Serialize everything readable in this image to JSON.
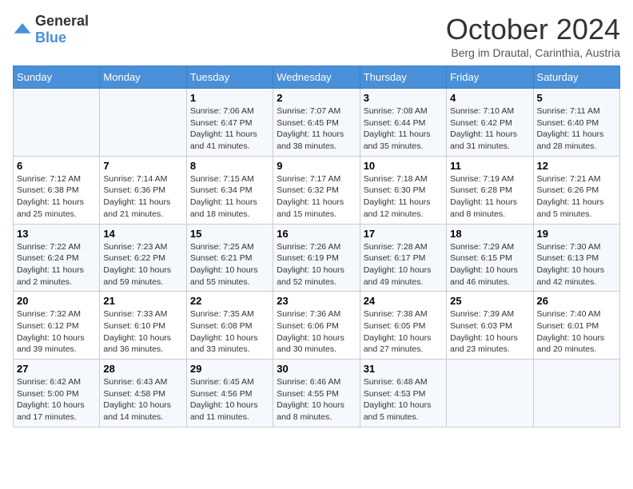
{
  "header": {
    "logo_general": "General",
    "logo_blue": "Blue",
    "month_title": "October 2024",
    "subtitle": "Berg im Drautal, Carinthia, Austria"
  },
  "days_of_week": [
    "Sunday",
    "Monday",
    "Tuesday",
    "Wednesday",
    "Thursday",
    "Friday",
    "Saturday"
  ],
  "weeks": [
    [
      {
        "day": "",
        "sunrise": "",
        "sunset": "",
        "daylight": ""
      },
      {
        "day": "",
        "sunrise": "",
        "sunset": "",
        "daylight": ""
      },
      {
        "day": "1",
        "sunrise": "Sunrise: 7:06 AM",
        "sunset": "Sunset: 6:47 PM",
        "daylight": "Daylight: 11 hours and 41 minutes."
      },
      {
        "day": "2",
        "sunrise": "Sunrise: 7:07 AM",
        "sunset": "Sunset: 6:45 PM",
        "daylight": "Daylight: 11 hours and 38 minutes."
      },
      {
        "day": "3",
        "sunrise": "Sunrise: 7:08 AM",
        "sunset": "Sunset: 6:44 PM",
        "daylight": "Daylight: 11 hours and 35 minutes."
      },
      {
        "day": "4",
        "sunrise": "Sunrise: 7:10 AM",
        "sunset": "Sunset: 6:42 PM",
        "daylight": "Daylight: 11 hours and 31 minutes."
      },
      {
        "day": "5",
        "sunrise": "Sunrise: 7:11 AM",
        "sunset": "Sunset: 6:40 PM",
        "daylight": "Daylight: 11 hours and 28 minutes."
      }
    ],
    [
      {
        "day": "6",
        "sunrise": "Sunrise: 7:12 AM",
        "sunset": "Sunset: 6:38 PM",
        "daylight": "Daylight: 11 hours and 25 minutes."
      },
      {
        "day": "7",
        "sunrise": "Sunrise: 7:14 AM",
        "sunset": "Sunset: 6:36 PM",
        "daylight": "Daylight: 11 hours and 21 minutes."
      },
      {
        "day": "8",
        "sunrise": "Sunrise: 7:15 AM",
        "sunset": "Sunset: 6:34 PM",
        "daylight": "Daylight: 11 hours and 18 minutes."
      },
      {
        "day": "9",
        "sunrise": "Sunrise: 7:17 AM",
        "sunset": "Sunset: 6:32 PM",
        "daylight": "Daylight: 11 hours and 15 minutes."
      },
      {
        "day": "10",
        "sunrise": "Sunrise: 7:18 AM",
        "sunset": "Sunset: 6:30 PM",
        "daylight": "Daylight: 11 hours and 12 minutes."
      },
      {
        "day": "11",
        "sunrise": "Sunrise: 7:19 AM",
        "sunset": "Sunset: 6:28 PM",
        "daylight": "Daylight: 11 hours and 8 minutes."
      },
      {
        "day": "12",
        "sunrise": "Sunrise: 7:21 AM",
        "sunset": "Sunset: 6:26 PM",
        "daylight": "Daylight: 11 hours and 5 minutes."
      }
    ],
    [
      {
        "day": "13",
        "sunrise": "Sunrise: 7:22 AM",
        "sunset": "Sunset: 6:24 PM",
        "daylight": "Daylight: 11 hours and 2 minutes."
      },
      {
        "day": "14",
        "sunrise": "Sunrise: 7:23 AM",
        "sunset": "Sunset: 6:22 PM",
        "daylight": "Daylight: 10 hours and 59 minutes."
      },
      {
        "day": "15",
        "sunrise": "Sunrise: 7:25 AM",
        "sunset": "Sunset: 6:21 PM",
        "daylight": "Daylight: 10 hours and 55 minutes."
      },
      {
        "day": "16",
        "sunrise": "Sunrise: 7:26 AM",
        "sunset": "Sunset: 6:19 PM",
        "daylight": "Daylight: 10 hours and 52 minutes."
      },
      {
        "day": "17",
        "sunrise": "Sunrise: 7:28 AM",
        "sunset": "Sunset: 6:17 PM",
        "daylight": "Daylight: 10 hours and 49 minutes."
      },
      {
        "day": "18",
        "sunrise": "Sunrise: 7:29 AM",
        "sunset": "Sunset: 6:15 PM",
        "daylight": "Daylight: 10 hours and 46 minutes."
      },
      {
        "day": "19",
        "sunrise": "Sunrise: 7:30 AM",
        "sunset": "Sunset: 6:13 PM",
        "daylight": "Daylight: 10 hours and 42 minutes."
      }
    ],
    [
      {
        "day": "20",
        "sunrise": "Sunrise: 7:32 AM",
        "sunset": "Sunset: 6:12 PM",
        "daylight": "Daylight: 10 hours and 39 minutes."
      },
      {
        "day": "21",
        "sunrise": "Sunrise: 7:33 AM",
        "sunset": "Sunset: 6:10 PM",
        "daylight": "Daylight: 10 hours and 36 minutes."
      },
      {
        "day": "22",
        "sunrise": "Sunrise: 7:35 AM",
        "sunset": "Sunset: 6:08 PM",
        "daylight": "Daylight: 10 hours and 33 minutes."
      },
      {
        "day": "23",
        "sunrise": "Sunrise: 7:36 AM",
        "sunset": "Sunset: 6:06 PM",
        "daylight": "Daylight: 10 hours and 30 minutes."
      },
      {
        "day": "24",
        "sunrise": "Sunrise: 7:38 AM",
        "sunset": "Sunset: 6:05 PM",
        "daylight": "Daylight: 10 hours and 27 minutes."
      },
      {
        "day": "25",
        "sunrise": "Sunrise: 7:39 AM",
        "sunset": "Sunset: 6:03 PM",
        "daylight": "Daylight: 10 hours and 23 minutes."
      },
      {
        "day": "26",
        "sunrise": "Sunrise: 7:40 AM",
        "sunset": "Sunset: 6:01 PM",
        "daylight": "Daylight: 10 hours and 20 minutes."
      }
    ],
    [
      {
        "day": "27",
        "sunrise": "Sunrise: 6:42 AM",
        "sunset": "Sunset: 5:00 PM",
        "daylight": "Daylight: 10 hours and 17 minutes."
      },
      {
        "day": "28",
        "sunrise": "Sunrise: 6:43 AM",
        "sunset": "Sunset: 4:58 PM",
        "daylight": "Daylight: 10 hours and 14 minutes."
      },
      {
        "day": "29",
        "sunrise": "Sunrise: 6:45 AM",
        "sunset": "Sunset: 4:56 PM",
        "daylight": "Daylight: 10 hours and 11 minutes."
      },
      {
        "day": "30",
        "sunrise": "Sunrise: 6:46 AM",
        "sunset": "Sunset: 4:55 PM",
        "daylight": "Daylight: 10 hours and 8 minutes."
      },
      {
        "day": "31",
        "sunrise": "Sunrise: 6:48 AM",
        "sunset": "Sunset: 4:53 PM",
        "daylight": "Daylight: 10 hours and 5 minutes."
      },
      {
        "day": "",
        "sunrise": "",
        "sunset": "",
        "daylight": ""
      },
      {
        "day": "",
        "sunrise": "",
        "sunset": "",
        "daylight": ""
      }
    ]
  ]
}
